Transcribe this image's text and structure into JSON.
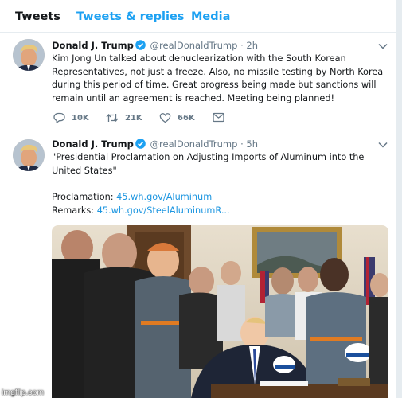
{
  "tabs": [
    {
      "label": "Tweets",
      "active": true
    },
    {
      "label": "Tweets & replies",
      "active": false
    },
    {
      "label": "Media",
      "active": false
    }
  ],
  "tweets": [
    {
      "author": {
        "name": "Donald J. Trump",
        "handle": "@realDonaldTrump",
        "verified": true
      },
      "separator": "·",
      "time": "2h",
      "text": "Kim Jong Un talked about denuclearization with the South Korean Representatives, not just a freeze. Also, no missile testing by North Korea during this period of time. Great progress being made but sanctions will remain until an agreement is reached. Meeting being planned!",
      "actions": {
        "replies": "10K",
        "retweets": "21K",
        "likes": "66K"
      }
    },
    {
      "author": {
        "name": "Donald J. Trump",
        "handle": "@realDonaldTrump",
        "verified": true
      },
      "separator": "·",
      "time": "5h",
      "text": "\"Presidential Proclamation on Adjusting Imports of Aluminum into the United States\"",
      "links": [
        {
          "label": "Proclamation:",
          "url": "45.wh.gov/Aluminum"
        },
        {
          "label": "Remarks:",
          "url": "45.wh.gov/SteelAluminumR..."
        }
      ]
    }
  ],
  "watermark": "imgflip.com",
  "colors": {
    "accent": "#1da1f2",
    "link": "#1b95e0",
    "muted": "#657786",
    "border": "#e6ecf0",
    "text": "#14171a"
  },
  "icons": [
    "verified-badge-icon",
    "chevron-down-icon",
    "reply-icon",
    "retweet-icon",
    "like-icon",
    "message-icon"
  ]
}
